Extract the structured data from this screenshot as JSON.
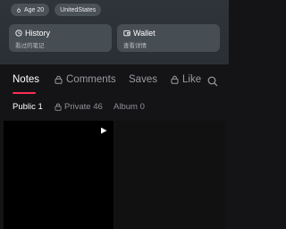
{
  "profile": {
    "tags": [
      {
        "icon": "gender-icon",
        "label": "Age 20"
      },
      {
        "label": "UnitedStates"
      }
    ],
    "cards": [
      {
        "icon": "history-icon",
        "title": "History",
        "subtitle": "看过的笔记"
      },
      {
        "icon": "wallet-icon",
        "title": "Wallet",
        "subtitle": "查看详情"
      }
    ]
  },
  "tabs": [
    {
      "label": "Notes",
      "active": true
    },
    {
      "label": "Comments",
      "locked": true
    },
    {
      "label": "Saves"
    },
    {
      "label": "Like",
      "locked": true
    }
  ],
  "subtabs": [
    {
      "label": "Public 1",
      "active": true
    },
    {
      "label": "Private 46",
      "locked": true
    },
    {
      "label": "Album 0"
    }
  ],
  "colors": {
    "accent": "#ff2d55",
    "header_bg": "#2e3439",
    "card_bg": "#464d53",
    "content_bg": "#141416"
  }
}
